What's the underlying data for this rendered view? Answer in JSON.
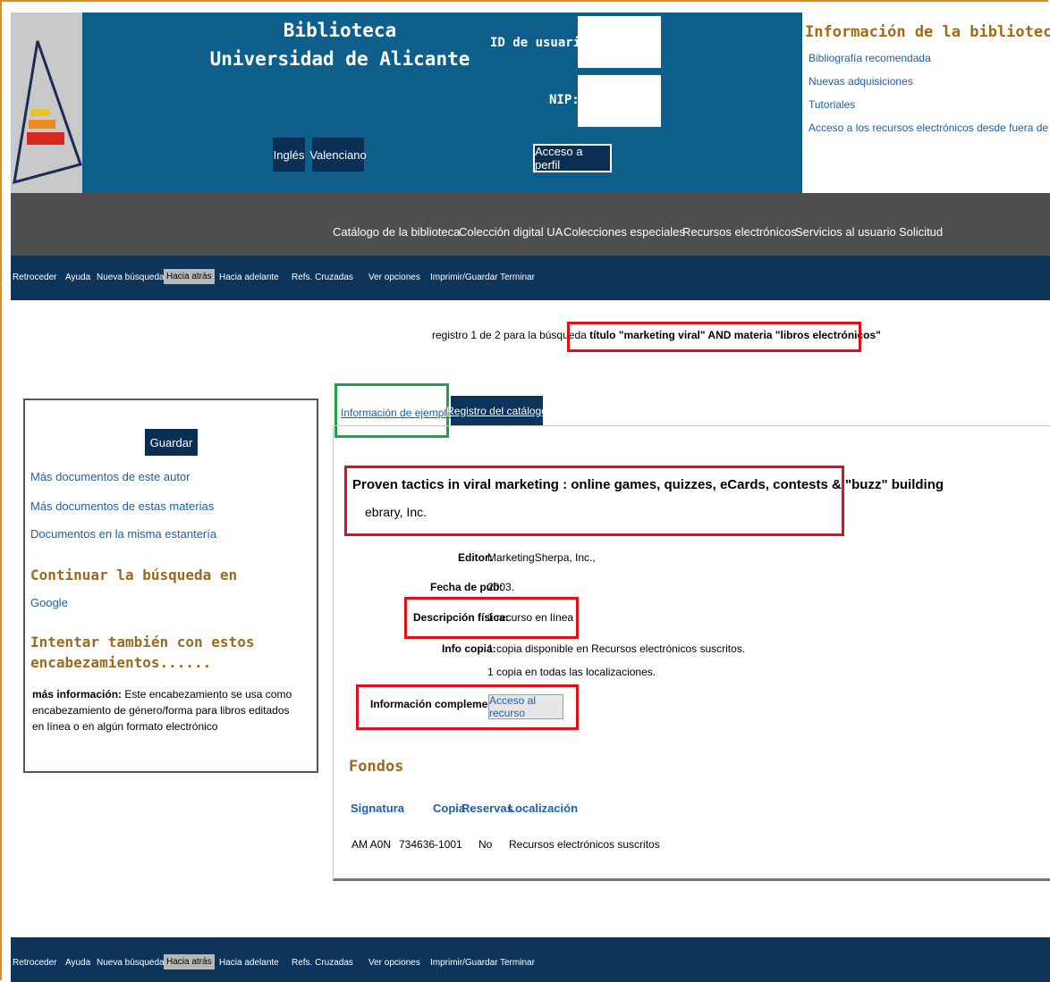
{
  "header": {
    "title_line1": "Biblioteca",
    "title_line2": "Universidad de Alicante",
    "lang_buttons": [
      "Inglés",
      "Valenciano"
    ],
    "user_id_label": "ID de usuario:",
    "pin_label": "NIP:",
    "profile_button": "Acceso a perfil"
  },
  "info": {
    "heading": "Información de la biblioteca",
    "links": [
      "Bibliografía recomendada",
      "Nuevas adquisiciones",
      "Tutoriales",
      "Acceso a los recursos electrónicos desde fuera de la UA"
    ]
  },
  "main_nav": [
    "Catálogo de la biblioteca",
    "Colección digital UA",
    "Colecciones especiales",
    "Recursos electrónicos",
    "Servicios al usuario",
    "Solicitud"
  ],
  "toolbar": [
    "Retroceder",
    "Ayuda",
    "Nueva búsqueda",
    "Hacia atrás",
    "Hacia adelante",
    "Refs. Cruzadas",
    "Ver opciones",
    "Imprimir/Guardar",
    "Terminar"
  ],
  "toolbar_active": "Hacia atrás",
  "summary": {
    "prefix": "registro 1 de 2 para la búsqueda",
    "query": "título \"marketing viral\" AND materia \"libros electrónicos\""
  },
  "left": {
    "save_button": "Guardar",
    "links": [
      "Más documentos de este autor",
      "Más documentos de estas materias",
      "Documentos en la misma estantería"
    ],
    "continue_heading": "Continuar la búsqueda en",
    "google": "Google",
    "try_heading_line1": "Intentar también con estos",
    "try_heading_line2": "encabezamientos......",
    "note_label": "más información:",
    "note_text": " Este encabezamiento se usa como encabezamiento de género/forma para libros editados en línea o en algún formato electrónico"
  },
  "tabs": {
    "item_info": "Información de ejemplar",
    "catalog": "Registro del catálogo"
  },
  "record": {
    "title": "Proven tactics in viral marketing : online games, quizzes, eCards, contests & \"buzz\" building",
    "author": "ebrary, Inc.",
    "editor_label": "Editor:",
    "editor_value": "MarketingSherpa, Inc.,",
    "date_label": "Fecha de pub:",
    "date_value": "2003.",
    "desc_label": "Descripción física:",
    "desc_value": "1 recurso en línea",
    "copy_label": "Info copia:",
    "copy_value1": "1 copia disponible en Recursos electrónicos suscritos.",
    "copy_value2": "1 copia en todas las localizaciones.",
    "extra_label": "Información complementaria",
    "resource_button": "Acceso al recurso"
  },
  "holdings": {
    "heading": "Fondos",
    "columns": [
      "Signatura",
      "Copia",
      "Reservas",
      "Localización"
    ],
    "row": [
      "AM A0N",
      "734636-1001",
      "No",
      "Recursos electrónicos suscritos"
    ]
  },
  "colors": {
    "header_blue": "#0f5f8d",
    "toolbar_navy": "#0d355c",
    "nav_gray": "#4f4f4f",
    "highlight_red": "#e0101a",
    "highlight_green": "#1fa24a",
    "heading_brown": "#9b6a1e",
    "link_blue": "#1d5fa8",
    "frame_orange": "#e38a1e"
  }
}
